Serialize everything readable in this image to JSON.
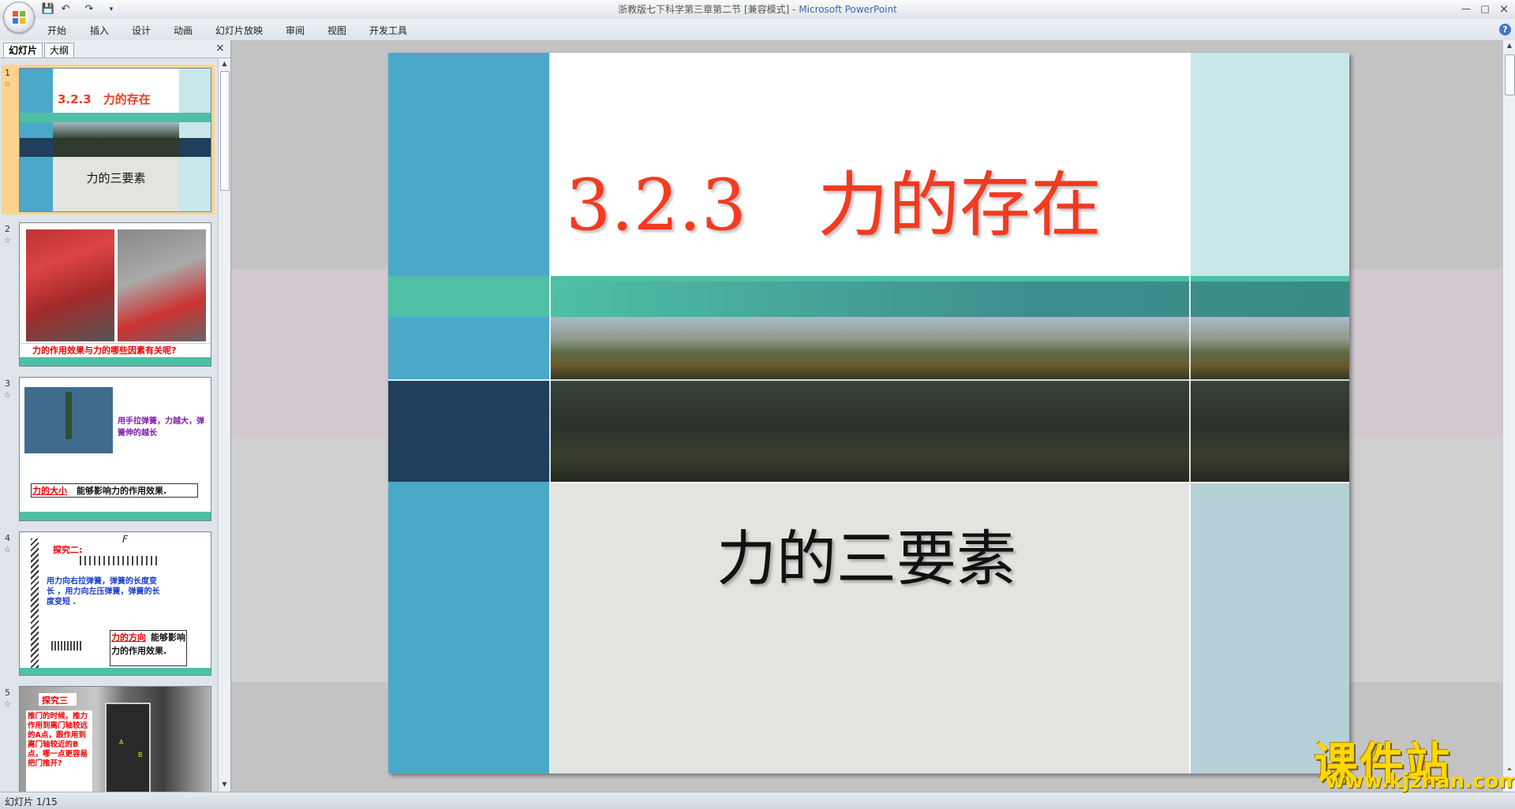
{
  "window": {
    "title": "浙教版七下科学第三章第二节 [兼容模式] - ",
    "app_name": "Microsoft PowerPoint",
    "minimize": "—",
    "maximize": "□",
    "close": "×"
  },
  "quick_access": {
    "save": "💾",
    "undo": "↶",
    "redo": "↷",
    "more": "▾"
  },
  "ribbon": {
    "tabs": [
      "开始",
      "插入",
      "设计",
      "动画",
      "幻灯片放映",
      "审阅",
      "视图",
      "开发工具"
    ],
    "help": "?"
  },
  "left_pane": {
    "tabs": [
      "幻灯片",
      "大纲"
    ],
    "close": "×",
    "thumbnails": [
      {
        "number": "1",
        "title": "3.2.3　力的存在",
        "subtitle": "力的三要素"
      },
      {
        "number": "2",
        "caption": "力的作用效果与力的哪些因素有关呢?"
      },
      {
        "number": "3",
        "note": "用手拉弹簧，力越大，弹簧伸的越长",
        "highlight": "力的大小",
        "caption": "能够影响力的作用效果."
      },
      {
        "number": "4",
        "heading": "探究二:",
        "label_f": "F",
        "text": "用力向右拉弹簧，弹簧的长度变 长 ，用力向左压弹簧，弹簧的长度变短 .",
        "highlight": "力的方向",
        "caption": "能够影响",
        "caption2": "力的作用效果."
      },
      {
        "number": "5",
        "heading": "探究三",
        "text": "推门的时候，推力作用到离门轴较远的A点，跟作用到离门轴较近的B点，哪一点更容易把门推开?",
        "label_a": "A",
        "label_b": "B"
      }
    ]
  },
  "slide": {
    "title": "3.2.3　力的存在",
    "subtitle": "力的三要素",
    "colors": {
      "title": "#f23b20",
      "teal": "#4ba8c8",
      "green": "#4fbfa5",
      "navy": "#1f3f5c",
      "light": "#c9e6ea"
    }
  },
  "status": {
    "slide_info": "幻灯片 1/15"
  },
  "watermark": {
    "main": "课件站",
    "url": "www.kjzhan.com"
  }
}
